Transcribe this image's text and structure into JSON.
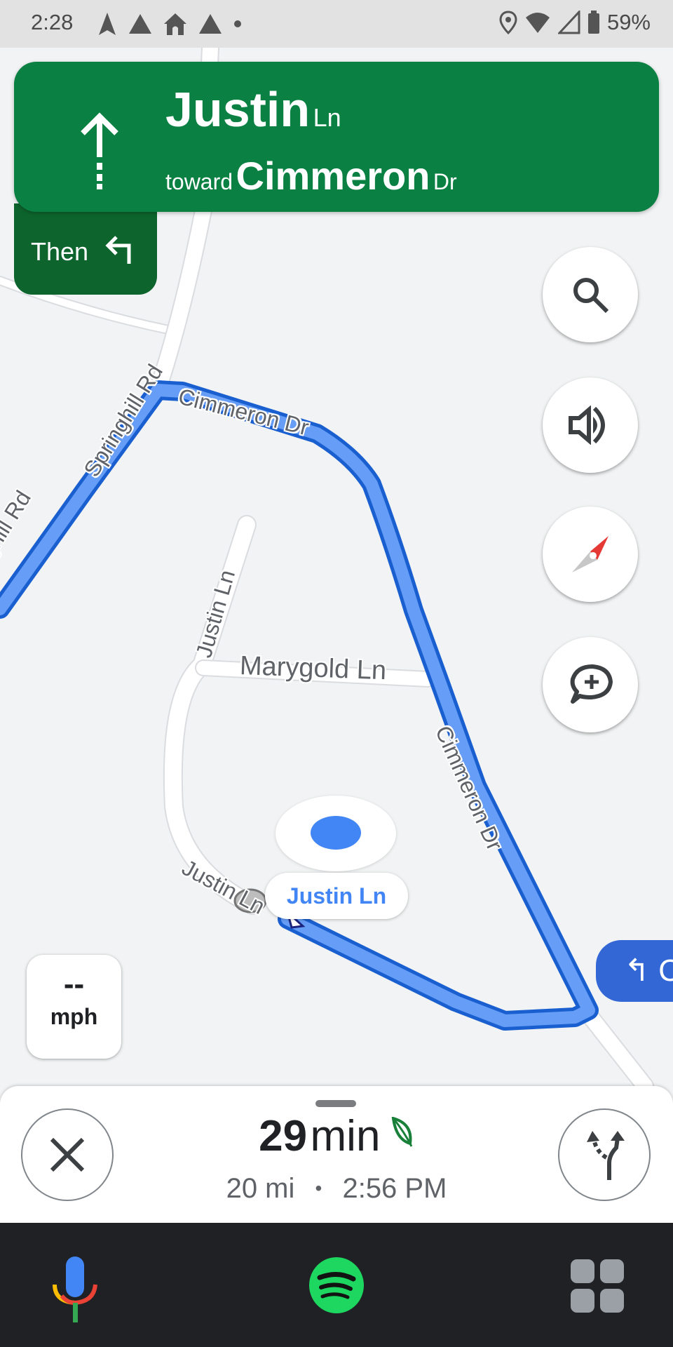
{
  "status_bar": {
    "time": "2:28",
    "left_icons": [
      "navigation-arrow-icon",
      "alert-triangle-icon",
      "home-icon",
      "alert-triangle-icon",
      "dot-icon"
    ],
    "right_icons": [
      "location-icon",
      "wifi-icon",
      "cell-signal-icon",
      "battery-icon"
    ],
    "battery": "59%"
  },
  "navigation": {
    "maneuver_icon": "straight-arrow-icon",
    "street_name": "Justin",
    "street_suffix": "Ln",
    "toward_label": "toward",
    "toward_name": "Cimmeron",
    "toward_suffix": "Dr",
    "then_label": "Then",
    "then_icon": "turn-left-icon"
  },
  "map": {
    "labels": {
      "springhill_upper": "Springhill Rd",
      "springhill_lower": "Springhill Rd",
      "cimmeron_top": "Cimmeron Dr",
      "cimmeron_right": "Cimmeron Dr",
      "justin_upper": "Justin Ln",
      "justin_lower": "Justin Ln",
      "marygold": "Marygold Ln"
    },
    "current_road_chip": "Justin Ln",
    "next_turn_chip": "↰ C",
    "route_color": "#4285f4",
    "route_border": "#1a5fd0"
  },
  "map_controls": [
    {
      "name": "search-button",
      "icon": "search-icon"
    },
    {
      "name": "sound-button",
      "icon": "volume-icon"
    },
    {
      "name": "compass-button",
      "icon": "compass-icon"
    },
    {
      "name": "report-button",
      "icon": "add-comment-icon"
    }
  ],
  "speed": {
    "value": "--",
    "unit": "mph"
  },
  "trip": {
    "duration_value": "29",
    "duration_unit": "min",
    "eco_icon": "leaf-icon",
    "distance": "20 mi",
    "separator": "•",
    "arrival": "2:56 PM",
    "close_icon": "close-icon",
    "alternates_icon": "alt-route-icon"
  },
  "nav_bar": {
    "items": [
      "microphone-icon",
      "spotify-icon",
      "app-grid-icon"
    ]
  },
  "colors": {
    "header_green": "#0b8043",
    "then_green": "#0d652d",
    "route_blue": "#4285f4",
    "chip_blue": "#3367d6",
    "eco_green": "#188038",
    "spotify_green": "#1ed760"
  }
}
